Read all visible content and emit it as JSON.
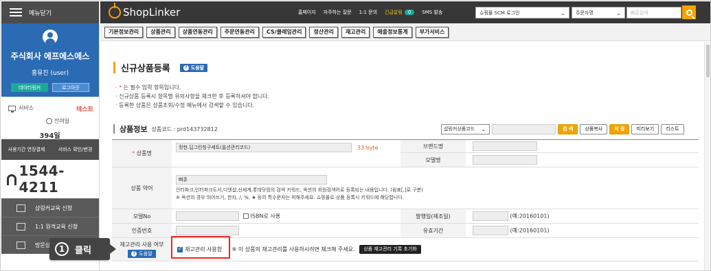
{
  "sidebar": {
    "menu_label": "메뉴닫기",
    "company": "주식회사 에프에스에스",
    "user": "홍유진 (user)",
    "btn_data": "데이터링커",
    "btn_logout": "로그아웃",
    "service_label": "서비스",
    "test_label": "테스트",
    "remain_label": "잔여일",
    "days": "394일",
    "extend_left": "사용기간 연장결제",
    "extend_right": "서비스 확인/변경",
    "phone": "1544-4211",
    "items": [
      "샵링커교육 신청",
      "1:1 원격교육 신청",
      "방문상담"
    ]
  },
  "topbar": {
    "logo": "ShopLinker",
    "links": [
      "홈페이지",
      "자주하는 질문",
      "1:1 문의"
    ],
    "cs_label": "긴급알림",
    "cs_count": "0",
    "sms": "SMS 발송",
    "scm_select": "쇼핑몰 SCM 로그인",
    "order_select": "주문자명",
    "search_placeholder": "빠른검색"
  },
  "menu": [
    "기본정보관리",
    "상품관리",
    "상품연동관리",
    "주문연동관리",
    "CS/클레임관리",
    "정산관리",
    "재고관리",
    "매출정보통계",
    "부가서비스"
  ],
  "main": {
    "title": "신규상품등록",
    "help": "도움말",
    "note_req": " 는 필수 입력 항목입니다.",
    "note_star": "*",
    "note2": "신규상품 등록시 항목별 유의사항을 체크한 후 등록하셔야 합니다.",
    "note3": "등록한 상품은 상품조회/수정 메뉴에서 검색할 수 있습니다.",
    "section": "상품정보",
    "product_code": "상품코드 : prd143732812",
    "shop_select": "샵링커상품코드",
    "btn_search": "검 색",
    "btn_copy": "상품복사",
    "btn_save": "저 장",
    "btn_preview": "미리보기",
    "btn_list": "리스트",
    "label_name": "상품명",
    "name_value": "정현.딥그린칭구세트(옵션관리코드)",
    "byte": "33 byte",
    "label_brand": "브랜드명",
    "label_model": "모델명",
    "label_abbr": "상품 약어",
    "abbr_value": "뻐쥬",
    "abbr_note1": "인터파크,인터파크도서,디앤샵,신세계,롯데닷컴의 검색 키워드, 옥션의 회원검색어로 등록되는 내용입니다. (쉼표[,]로 구분)",
    "abbr_note2": "※ 옥션의 경우 띄어쓰기, 한자, /, %, ★ 등의 특수문자는 피해주세요. 쇼핑몰로 상품 등록시 키워드에 해당합니다.",
    "label_modelno": "모델No",
    "isbn": "ISBN로 사용",
    "label_release": "발행일(제조일)",
    "release_example": "(예:20160101)",
    "label_cert": "인증번호",
    "label_expire": "유효기간",
    "expire_example": "(예:20160101)",
    "label_stock": "재고관리 사용 여부",
    "stock_help": "도움말",
    "stock_check": "재고관리 사용함",
    "stock_note": "※ 이 상품의 재고관리를 사용하시려면 체크해 주세요.",
    "stock_reset": "상품 재고관리 기록 초기화"
  },
  "callout": {
    "number": "1",
    "text": "클릭"
  }
}
